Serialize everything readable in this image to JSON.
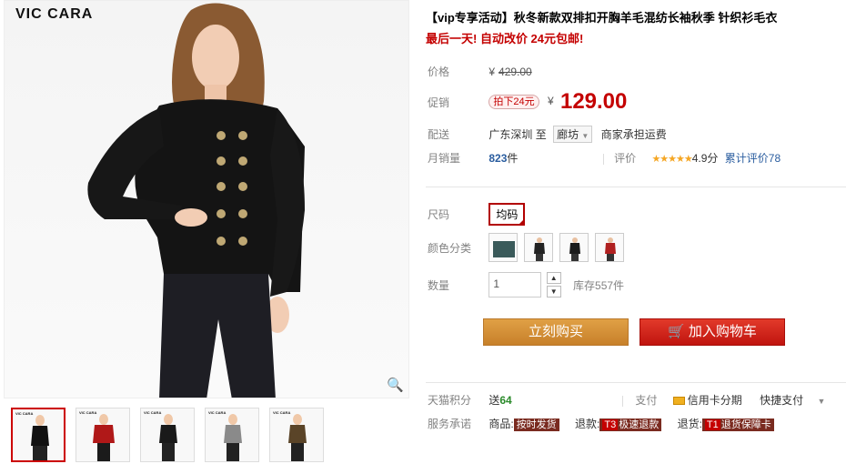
{
  "brand": "VIC CARA",
  "product": {
    "title": "【vip专享活动】秋冬新款双排扣开胸羊毛混纺长袖秋季 针织衫毛衣",
    "promo": "最后一天! 自动改价 24元包邮!"
  },
  "price": {
    "label": "价格",
    "currency": "¥",
    "original": "429.00"
  },
  "promo_price": {
    "label": "促销",
    "tag": "拍下24元",
    "currency": "¥",
    "value": "129.00"
  },
  "shipping": {
    "label": "配送",
    "from": "广东深圳",
    "to_word": "至",
    "to_select": "廊坊",
    "note": "商家承担运费"
  },
  "sales": {
    "label": "月销量",
    "count": "823",
    "unit": "件",
    "rating_label": "评价",
    "stars": "★★★★★",
    "score": "4.9分",
    "reviews": "累计评价78"
  },
  "size": {
    "label": "尺码",
    "option": "均码"
  },
  "color": {
    "label": "颜色分类",
    "swatch_colors": [
      "#3a5a5a",
      "#222222",
      "#1b1b1b",
      "#b02020"
    ]
  },
  "quantity": {
    "label": "数量",
    "value": "1",
    "up": "▲",
    "down": "▼",
    "stock": "库存557件"
  },
  "buttons": {
    "buy": "立刻购买",
    "cart": "加入购物车",
    "cart_icon": "🛒"
  },
  "points": {
    "label": "天猫积分",
    "send": "送",
    "value": "64",
    "pay_label": "支付",
    "credit": "信用卡分期",
    "quick": "快捷支付"
  },
  "service": {
    "label": "服务承诺",
    "goods": "商品:",
    "goods_pill": "按时发货",
    "refund": "退款:",
    "refund_key": "T3",
    "refund_pill": "极速退款",
    "return": "退货:",
    "return_key": "T1",
    "return_pill": "退货保障卡"
  },
  "icons": {
    "zoom": "magnifier-icon",
    "chevron": "chevron-down-icon"
  },
  "colors": {
    "accent_red": "#c40000",
    "buy_orange": "#c7802a",
    "link_blue": "#2a5d9f"
  }
}
